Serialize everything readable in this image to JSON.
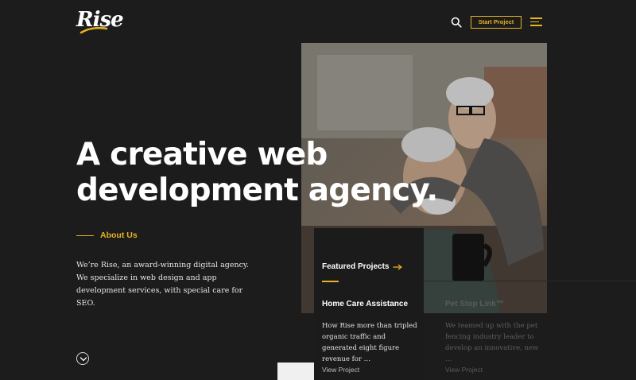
{
  "brand": {
    "logo_text": "Rise"
  },
  "header": {
    "cta_label": "Start Project"
  },
  "hero": {
    "headline_line1": "A creative web",
    "headline_line2": "development agency.",
    "about_label": "About Us",
    "intro": "We’re Rise, an award-winning digital agency. We specialize in web design and app development services, with special care for SEO."
  },
  "featured": {
    "title": "Featured Projects",
    "projects": [
      {
        "title": "Home Care Assistance",
        "desc": "How Rise more than tripled organic traffic and generated eight figure revenue for …",
        "link": "View Project"
      },
      {
        "title": "Pet Stop Link™",
        "desc": "We teamed up with the pet fencing industry leader to develop an innovative, new …",
        "link": "View Project"
      }
    ]
  },
  "colors": {
    "accent": "#e8b320",
    "background": "#1c1c1c"
  },
  "icons": [
    "search-icon",
    "hamburger-menu-icon",
    "arrow-right-icon",
    "chevron-down-icon"
  ]
}
